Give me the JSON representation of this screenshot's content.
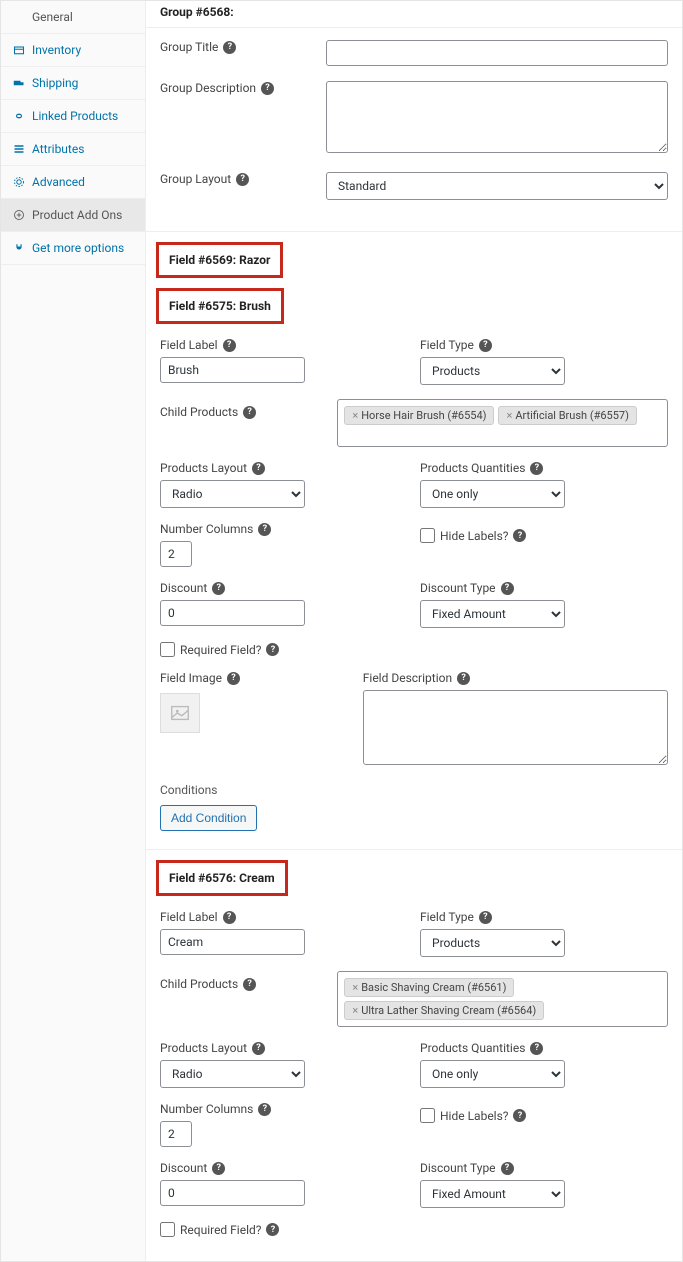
{
  "group_header": "Group #6568:",
  "sidebar": {
    "items": [
      {
        "label": "General"
      },
      {
        "label": "Inventory"
      },
      {
        "label": "Shipping"
      },
      {
        "label": "Linked Products"
      },
      {
        "label": "Attributes"
      },
      {
        "label": "Advanced"
      },
      {
        "label": "Product Add Ons"
      },
      {
        "label": "Get more options"
      }
    ]
  },
  "labels": {
    "group_title": "Group Title",
    "group_description": "Group Description",
    "group_layout": "Group Layout",
    "field_label": "Field Label",
    "field_type": "Field Type",
    "child_products": "Child Products",
    "products_layout": "Products Layout",
    "products_quantities": "Products Quantities",
    "number_columns": "Number Columns",
    "hide_labels": "Hide Labels?",
    "discount": "Discount",
    "discount_type": "Discount Type",
    "required_field": "Required Field?",
    "field_image": "Field Image",
    "field_description": "Field Description",
    "conditions": "Conditions",
    "add_condition": "Add Condition"
  },
  "group": {
    "layout": "Standard"
  },
  "field1": {
    "header": "Field #6569: Razor"
  },
  "field2": {
    "header": "Field #6575: Brush",
    "label_value": "Brush",
    "field_type": "Products",
    "child_products": [
      {
        "text": "Horse Hair Brush (#6554)"
      },
      {
        "text": "Artificial Brush (#6557)"
      }
    ],
    "products_layout": "Radio",
    "products_quantities": "One only",
    "number_columns": "2",
    "discount": "0",
    "discount_type": "Fixed Amount"
  },
  "field3": {
    "header": "Field #6576: Cream",
    "label_value": "Cream",
    "field_type": "Products",
    "child_products": [
      {
        "text": "Basic Shaving Cream (#6561)"
      },
      {
        "text": "Ultra Lather Shaving Cream (#6564)"
      }
    ],
    "products_layout": "Radio",
    "products_quantities": "One only",
    "number_columns": "2",
    "discount": "0",
    "discount_type": "Fixed Amount"
  }
}
